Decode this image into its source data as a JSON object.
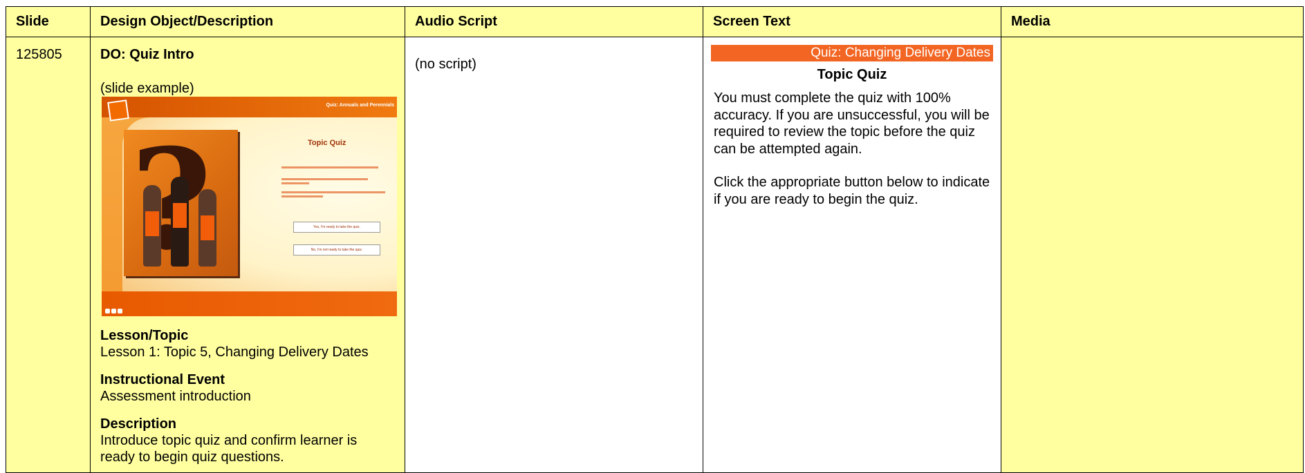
{
  "table": {
    "headers": {
      "slide": "Slide",
      "design": "Design Object/Description",
      "audio": "Audio Script",
      "screen": "Screen Text",
      "media": "Media"
    },
    "row": {
      "slide_number": "125805",
      "design_object": "DO: Quiz Intro",
      "slide_example_label": "(slide example)",
      "thumbnail": {
        "header_title": "Quiz: Annuals and Perennials",
        "quiz_title": "Topic Quiz",
        "button_yes": "Yes, I'm ready to take the quiz.",
        "button_no": "No, I'm not ready to take the quiz."
      },
      "sections": [
        {
          "label": "Lesson/Topic",
          "value": "Lesson 1: Topic 5, Changing Delivery Dates"
        },
        {
          "label": "Instructional Event",
          "value": "Assessment introduction"
        },
        {
          "label": "Description",
          "value": "Introduce topic quiz and confirm learner is ready to begin quiz questions."
        }
      ],
      "audio_script": "(no script)",
      "screen_text": {
        "banner": "Quiz: Changing Delivery Dates",
        "heading": "Topic Quiz",
        "paragraph_1": "You must complete the quiz with 100% accuracy. If you are unsuccessful, you will be required to review the topic before the quiz can be attempted again.",
        "paragraph_2": "Click the appropriate button below to indicate if you are ready to begin the quiz."
      },
      "media": ""
    }
  },
  "colors": {
    "cell_yellow": "#ffffa0",
    "banner_orange": "#f26522"
  }
}
